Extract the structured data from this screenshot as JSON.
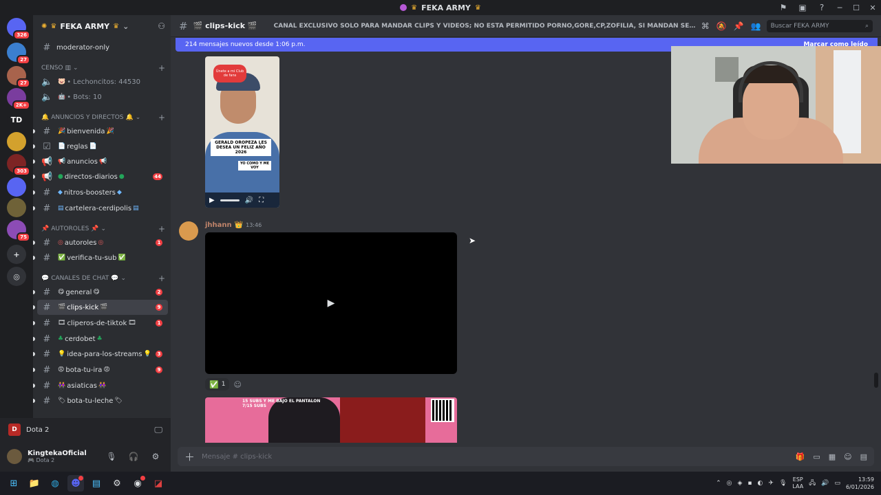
{
  "window": {
    "title": "FEKA ARMY",
    "controls": [
      "minimize",
      "maximize",
      "close"
    ]
  },
  "rail": {
    "servers": [
      {
        "label": "",
        "badge": "326",
        "color": "#5865f2"
      },
      {
        "label": "",
        "badge": "27",
        "color": "#3b7fcf"
      },
      {
        "label": "",
        "badge": "27",
        "color": "#a8634c"
      },
      {
        "label": "",
        "badge": "2K+",
        "color": "#7a3d9e"
      },
      {
        "label": "TD",
        "badge": "",
        "color": "#1e1f22"
      },
      {
        "label": "",
        "badge": "",
        "color": "#d3a12d"
      },
      {
        "label": "",
        "badge": "303",
        "color": "#7d2424"
      },
      {
        "label": "",
        "badge": "",
        "color": "#5865f2"
      },
      {
        "label": "",
        "badge": "",
        "color": "#6f6238"
      },
      {
        "label": "",
        "badge": "75",
        "color": "#8c4cb5"
      }
    ]
  },
  "guild": {
    "name": "FEKA ARMY",
    "channels": [
      {
        "name": "moderator-only",
        "type": "text",
        "badge": ""
      },
      {
        "name": "• Lechoncitos: 44530",
        "type": "voice",
        "badge": ""
      },
      {
        "name": "• Bots: 10",
        "type": "voice",
        "badge": ""
      },
      {
        "name": "bienvenida",
        "type": "text",
        "badge": ""
      },
      {
        "name": "reglas",
        "type": "rules",
        "badge": ""
      },
      {
        "name": "anuncios",
        "type": "announce",
        "badge": ""
      },
      {
        "name": "directos-diarios",
        "type": "announce",
        "badge": "44"
      },
      {
        "name": "nitros-boosters",
        "type": "text",
        "badge": ""
      },
      {
        "name": "cartelera-cerdipolis",
        "type": "text",
        "badge": ""
      },
      {
        "name": "autoroles",
        "type": "text",
        "badge": "1"
      },
      {
        "name": "verifica-tu-sub",
        "type": "text",
        "badge": ""
      },
      {
        "name": "general",
        "type": "text",
        "badge": "2"
      },
      {
        "name": "clips-kick",
        "type": "text",
        "badge": "9"
      },
      {
        "name": "cliperos-de-tiktok",
        "type": "text",
        "badge": "1"
      },
      {
        "name": "cerdobet",
        "type": "text",
        "badge": ""
      },
      {
        "name": "idea-para-los-streams",
        "type": "text",
        "badge": "3"
      },
      {
        "name": "bota-tu-ira",
        "type": "text",
        "badge": "9"
      },
      {
        "name": "asiaticas",
        "type": "text",
        "badge": ""
      },
      {
        "name": "tu-leche",
        "type": "text",
        "badge": ""
      }
    ],
    "categories": [
      "CENSO",
      "ANUNCIOS Y DIRECTOS",
      "AUTOROLES",
      "CANALES DE CHAT"
    ]
  },
  "voice": {
    "game": "Dota 2"
  },
  "user": {
    "name": "KingtekaOficial",
    "status": "Dota 2"
  },
  "header": {
    "channel": "clips-kick",
    "topic": "CANAL EXCLUSIVO SOLO PARA MANDAR CLIPS Y VIDEOS; NO ESTA PERMITIDO PORNO,GORE,CP,ZOFILIA, SI MANDAN SERA BANEADO PERMA...",
    "search_placeholder": "Buscar FEKA ARMY"
  },
  "banner": {
    "text": "214 mensajes nuevos desde 1:06 p.m.",
    "action": "Marcar como leído"
  },
  "video1": {
    "sticker": "Únete a mi Club de fans",
    "caption": "GERALD OROPEZA LES DESEA UN FELIZ AÑO 2026",
    "caption2": "YO COMO Y ME VOY"
  },
  "message": {
    "author": "jhhann",
    "time": "13:46",
    "reaction_count": "1"
  },
  "video3": {
    "text": "15 SUBS Y ME BAJO EL PANTALON\n7/15 SUBS"
  },
  "composer": {
    "placeholder": "Mensaje # clips-kick"
  },
  "taskbar": {
    "lang1": "ESP",
    "lang2": "LAA",
    "time": "13:59",
    "date": "6/01/2026"
  }
}
